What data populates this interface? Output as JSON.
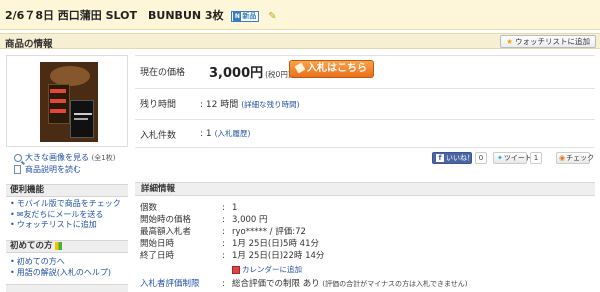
{
  "title": {
    "text": "2/6７8日  西口蒲田 SLOT　BUNBUN 3枚",
    "new_badge": "新品"
  },
  "section": {
    "title": "商品の情報",
    "watch_label": "ウォッチリストに追加"
  },
  "image_links": {
    "view_large": "大きな画像を見る",
    "count": "(全1枚)",
    "description": "商品説明を読む"
  },
  "sidebar": {
    "convenience_title": "便利機能",
    "convenience_items": [
      "モバイル版で商品をチェック",
      "友だちにメールを送る",
      "ウォッチリストに追加"
    ],
    "beginner_title": "初めての方",
    "beginner_items": [
      "初めての方へ",
      "用語の解説(入札のヘルプ)"
    ]
  },
  "main": {
    "price_label": "現在の価格",
    "price_value": "3,000円",
    "price_tax": "(税0円)",
    "bid_button": "入札はこちら",
    "remaining_label": "残り時間",
    "remaining_value": ": 12 時間",
    "remaining_link": "(詳細な残り時間)",
    "bids_label": "入札件数",
    "bids_value": ": 1",
    "bids_link": "(入札履歴)"
  },
  "social": {
    "like": "いいね！",
    "like_count": "0",
    "tweet": "ツイート",
    "tweet_count": "1",
    "check": "チェック"
  },
  "details": {
    "header": "詳細情報",
    "rows": [
      {
        "key": "個数",
        "value": "1"
      },
      {
        "key": "開始時の価格",
        "value": "3,000 円"
      },
      {
        "key": "最高額入札者",
        "value": "ryo***** / 評価:72"
      },
      {
        "key": "開始日時",
        "value": "1月 25日(日)5時 41分"
      },
      {
        "key": "終了日時",
        "value": "1月 25日(日)22時 14分"
      }
    ],
    "calendar_link": "カレンダーに追加",
    "restriction_key": "入札者評価制限",
    "restriction_value": "総合評価での制限 あり",
    "restriction_note": "(評価の合計がマイナスの方は入札できません)"
  },
  "colors": {
    "title_bg": "#fdf6d8",
    "bid_button": "#f08a2c",
    "link": "#2450a6"
  }
}
